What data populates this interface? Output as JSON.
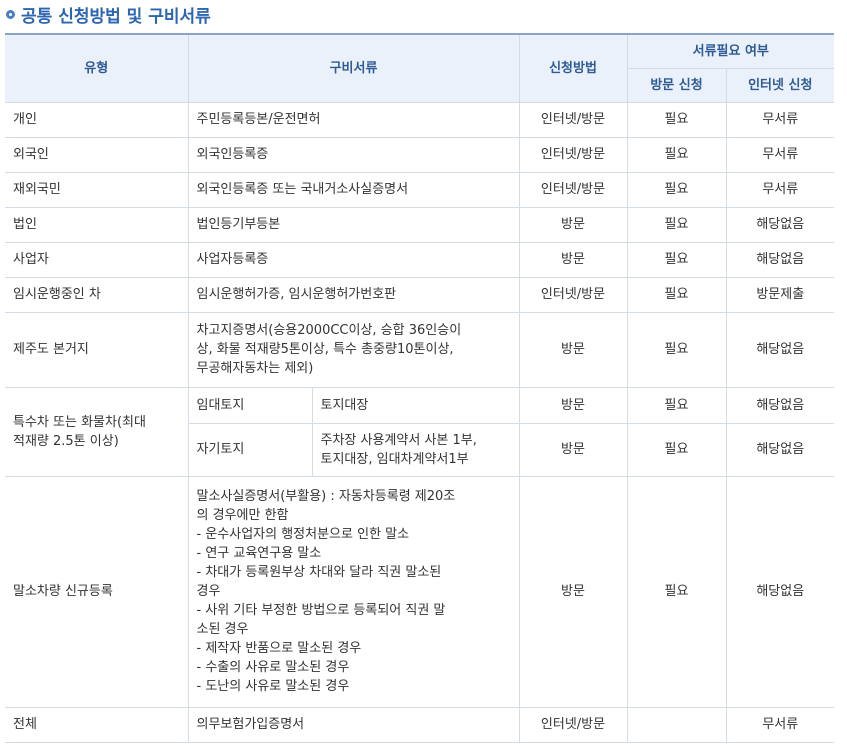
{
  "section": {
    "title": "공통 신청방법 및 구비서류",
    "bullet_color": "#4a7fc0"
  },
  "headers": {
    "type": "유형",
    "documents": "구비서류",
    "method": "신청방법",
    "need": "서류필요 여부",
    "visit": "방문 신청",
    "internet": "인터넷 신청"
  },
  "rows": [
    {
      "type": "개인",
      "doc": "주민등록등본/운전면허",
      "method": "인터넷/방문",
      "visit": "필요",
      "internet": "무서류"
    },
    {
      "type": "외국인",
      "doc": "외국인등록증",
      "method": "인터넷/방문",
      "visit": "필요",
      "internet": "무서류"
    },
    {
      "type": "재외국민",
      "doc": "외국인등록증 또는 국내거소사실증명서",
      "method": "인터넷/방문",
      "visit": "필요",
      "internet": "무서류"
    },
    {
      "type": "법인",
      "doc": "법인등기부등본",
      "method": "방문",
      "visit": "필요",
      "internet": "해당없음"
    },
    {
      "type": "사업자",
      "doc": "사업자등록증",
      "method": "방문",
      "visit": "필요",
      "internet": "해당없음"
    },
    {
      "type": "임시운행중인 차",
      "doc": "임시운행허가증, 임시운행허가번호판",
      "method": "인터넷/방문",
      "visit": "필요",
      "internet": "방문제출"
    },
    {
      "type": "제주도 본거지",
      "doc_lines": [
        "차고지증명서(승용2000CC이상, 승합 36인승이",
        "상, 화물 적재량5톤이상, 특수 총중량10톤이상,",
        "무공해자동차는 제외)"
      ],
      "method": "방문",
      "visit": "필요",
      "internet": "해당없음"
    }
  ],
  "special": {
    "type_lines": [
      "특수차 또는 화물차(최대",
      "적재량 2.5톤 이상)"
    ],
    "sub": [
      {
        "label": "임대토지",
        "doc_lines": [
          "토지대장"
        ],
        "method": "방문",
        "visit": "필요",
        "internet": "해당없음"
      },
      {
        "label": "자기토지",
        "doc_lines": [
          "주차장 사용계약서 사본 1부,",
          "토지대장, 임대차계약서1부"
        ],
        "method": "방문",
        "visit": "필요",
        "internet": "해당없음"
      }
    ]
  },
  "cancel": {
    "type": "말소차량 신규등록",
    "doc_lines": [
      "말소사실증명서(부활용) : 자동차등록령 제20조",
      "의 경우에만 한함",
      "- 운수사업자의 행정처분으로 인한 말소",
      "- 연구 교육연구용 말소",
      "- 차대가 등록원부상 차대와 달라 직권 말소된",
      "경우",
      "- 사위 기타 부정한 방법으로 등록되어 직권 말",
      "소된 경우",
      "- 제작자 반품으로 말소된 경우",
      "- 수출의 사유로 말소된 경우",
      "- 도난의 사유로 말소된 경우"
    ],
    "method": "방문",
    "visit": "필요",
    "internet": "해당없음"
  },
  "total": {
    "type": "전체",
    "doc": "의무보험가입증명서",
    "method": "인터넷/방문",
    "visit": "",
    "internet": "무서류"
  }
}
